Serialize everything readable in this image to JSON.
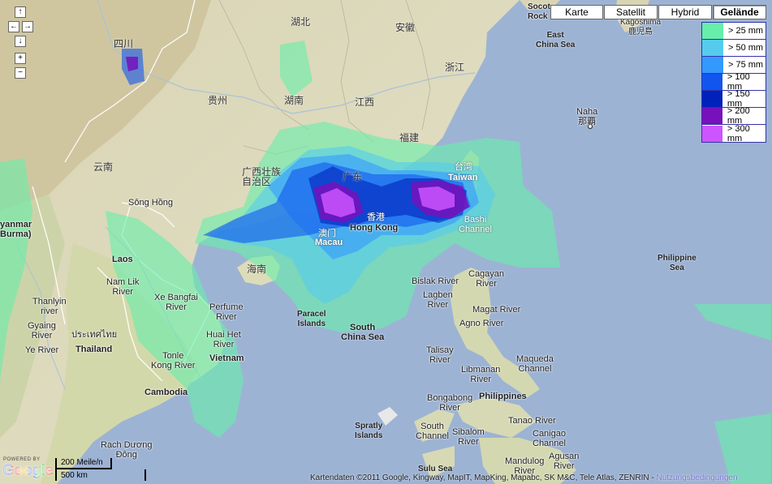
{
  "map_type": {
    "buttons": [
      {
        "label": "Karte",
        "active": false
      },
      {
        "label": "Satellit",
        "active": false
      },
      {
        "label": "Hybrid",
        "active": false
      },
      {
        "label": "Gelände",
        "active": true
      }
    ]
  },
  "legend": {
    "items": [
      {
        "label": "> 25 mm",
        "color": "#66eeaa"
      },
      {
        "label": "> 50 mm",
        "color": "#55ccee"
      },
      {
        "label": "> 75 mm",
        "color": "#3399ff"
      },
      {
        "label": "> 100 mm",
        "color": "#1155ee"
      },
      {
        "label": "> 150 mm",
        "color": "#0022bb"
      },
      {
        "label": "> 200 mm",
        "color": "#7711bb"
      },
      {
        "label": "> 300 mm",
        "color": "#cc55ff"
      }
    ]
  },
  "controls": {
    "up": "↑",
    "left": "←",
    "right": "→",
    "down": "↓",
    "zoom_in": "+",
    "zoom_out": "−"
  },
  "labels": {
    "sichuan": "四川",
    "hubei": "湖北",
    "anhui": "安徽",
    "zhejiang": "浙江",
    "guizhou": "贵州",
    "hunan": "湖南",
    "jiangxi": "江西",
    "fujian": "福建",
    "yunnan": "云南",
    "guangxi": "广西壮族\n自治区",
    "guangdong": "广东",
    "taiwan_cn": "台湾",
    "taiwan": "Taiwan",
    "hongkong_cn": "香港",
    "hongkong": "Hong Kong",
    "macau_cn": "澳门",
    "macau": "Macau",
    "hainan": "海南",
    "songhong": "Sông Hồng",
    "myanmar": "yanmar\nBurma)",
    "laos": "Laos",
    "nam_lik": "Nam Lik\nRiver",
    "xe_bangfai": "Xe Bangfai\nRiver",
    "perfume": "Perfume\nRiver",
    "thanlyin": "Thanlyin\nriver",
    "gyaing": "Gyaing\nRiver",
    "ye_river": "Ye River",
    "thai": "ประเทศไทย",
    "thailand": "Thailand",
    "huai_het": "Huai Het\nRiver",
    "vietnam": "Vietnam",
    "tonle": "Tonle\nKong River",
    "cambodia": "Cambodia",
    "rach_duong": "Rạch Dương\nĐông",
    "paracel": "Paracel\nIslands",
    "south_china_sea": "South\nChina Sea",
    "spratly": "Spratly\nIslands",
    "south_channel": "South\nChannel",
    "sulu_sea": "Sulu Sea",
    "bashi": "Bashi\nChannel",
    "bislak": "Bislak River",
    "cagayan": "Cagayan\nRiver",
    "lagben": "Lagben\nRiver",
    "magat": "Magat River",
    "agno": "Agno River",
    "talisay": "Talisay\nRiver",
    "libmanan": "Libmanan\nRiver",
    "maqueda": "Maqueda\nChannel",
    "philippines": "Philippines",
    "bongabong": "Bongabong\nRiver",
    "sibalom": "Sibalom\nRiver",
    "tanao": "Tanao River",
    "canigao": "Canigao\nChannel",
    "mandulog": "Mandulog\nRiver",
    "agusan": "Agusan\nRiver",
    "east_china_sea": "East\nChina Sea",
    "philippine_sea": "Philippine\nSea",
    "naha": "Naha\n那覇",
    "kagoshima": "Kagoshima\n鹿児島",
    "socotra": "Socot\nRock"
  },
  "footer": {
    "powered": "POWERED BY",
    "logo": "Google",
    "scale_miles": "200 Meile/n",
    "scale_km": "500 km",
    "copyright": "Kartendaten ©2011 Google, Kingway, MapIT, MapKing, Mapabc, SK M&C, Tele Atlas, ZENRIN - ",
    "terms": "Nutzungsbedingungen"
  }
}
